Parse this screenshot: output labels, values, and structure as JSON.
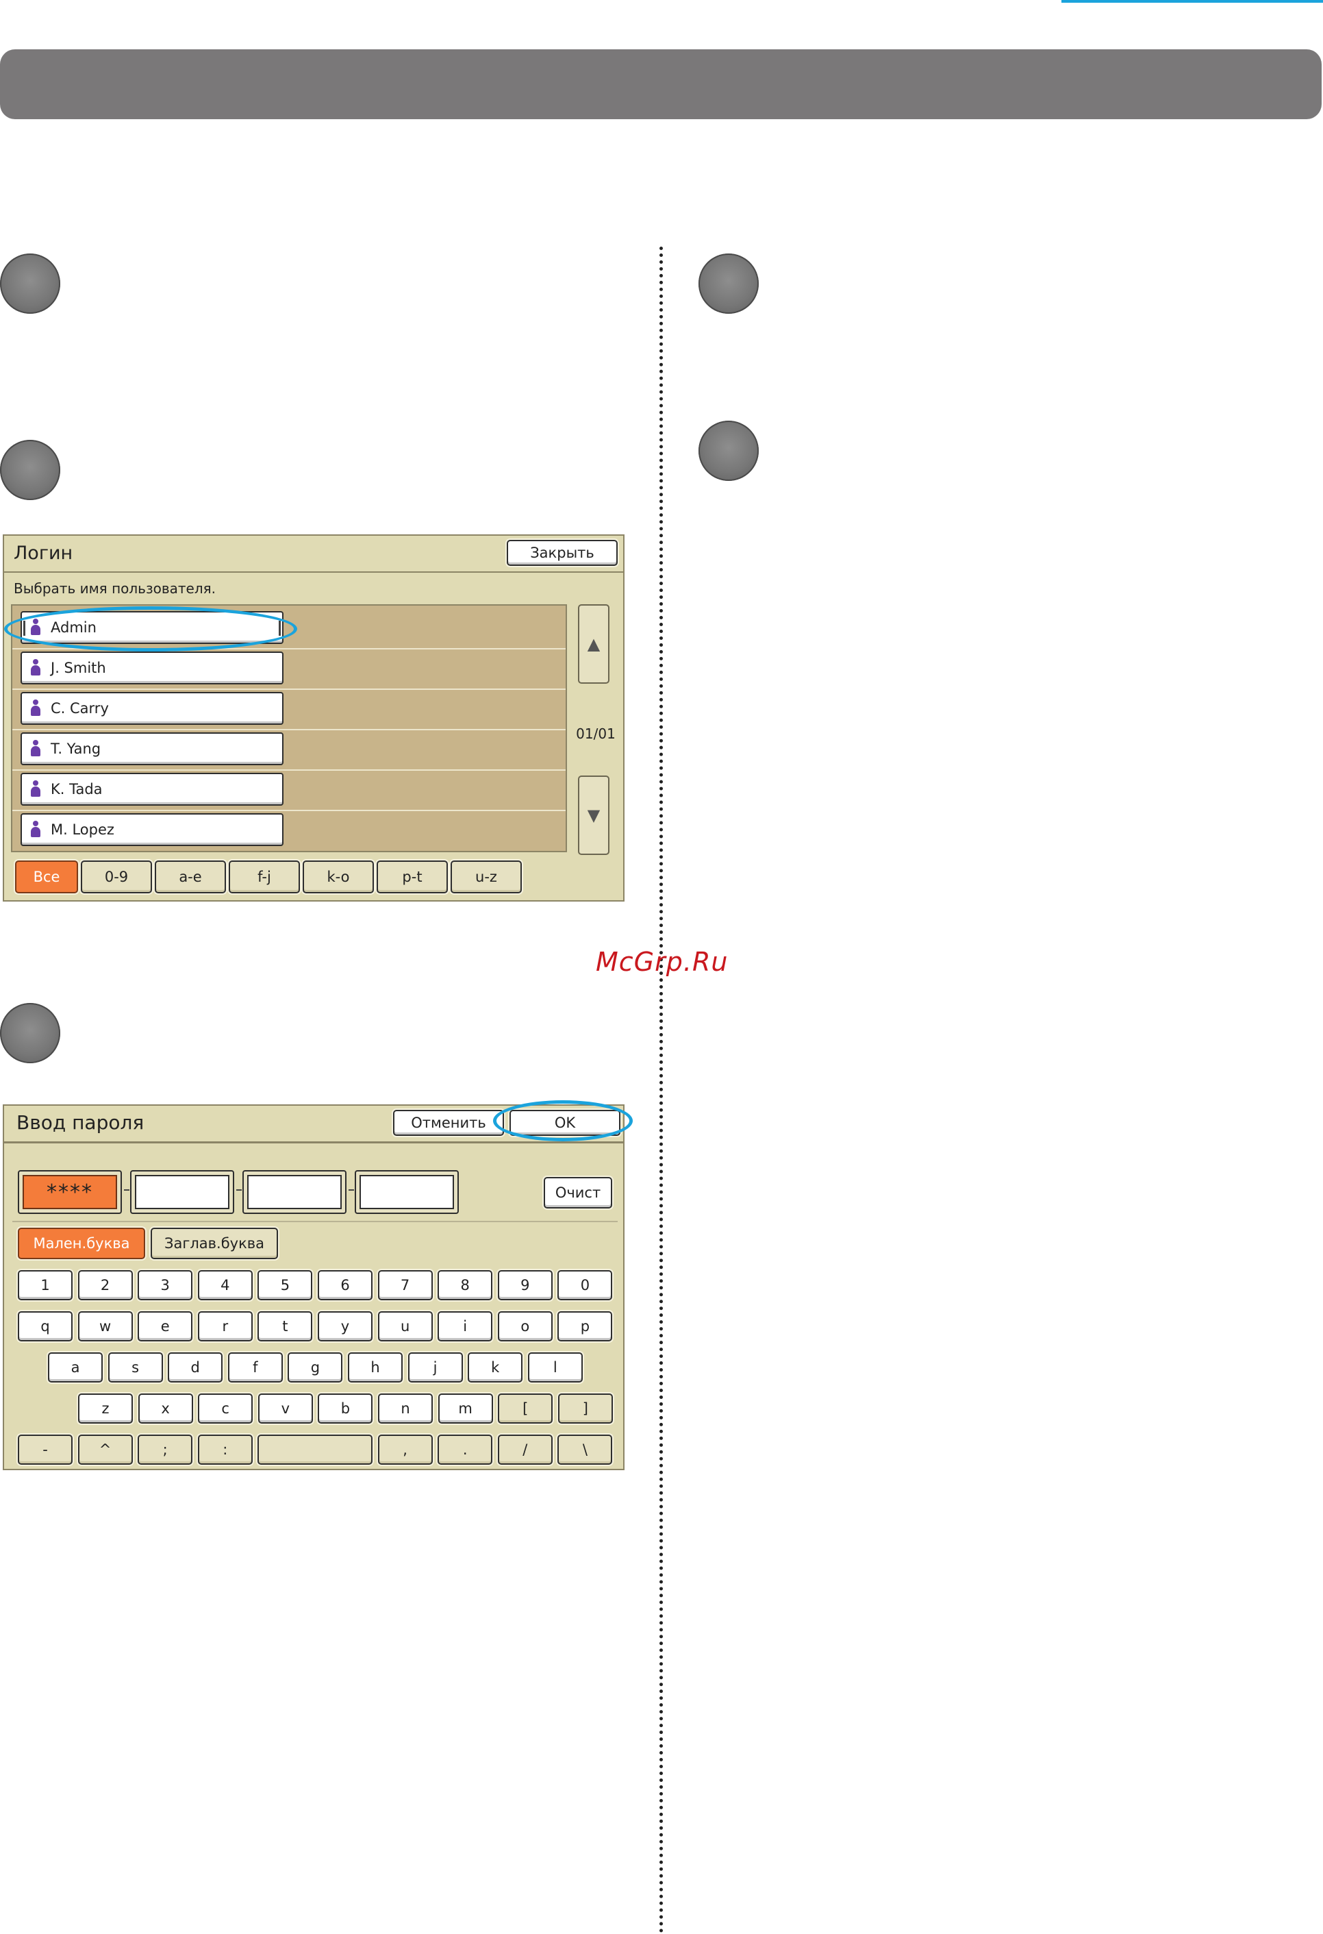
{
  "watermark": "McGrp.Ru",
  "colors": {
    "accent": "#1ba3dc",
    "header": "#7a7879",
    "panel": "#e0dbb4",
    "selected": "#f47c3a",
    "watermark": "#c9181e"
  },
  "login_panel": {
    "title": "Логин",
    "close_label": "Закрыть",
    "instruction": "Выбрать имя пользователя.",
    "users": [
      "Admin",
      "J. Smith",
      "C. Carry",
      "T. Yang",
      "K. Tada",
      "M. Lopez"
    ],
    "selected_user": "Admin",
    "page_indicator": "01/01",
    "scroll_up_icon": "▲",
    "scroll_down_icon": "▼",
    "filters": [
      "Все",
      "0-9",
      "a-e",
      "f-j",
      "k-o",
      "p-t",
      "u-z"
    ],
    "active_filter": "Все"
  },
  "password_panel": {
    "title": "Ввод пароля",
    "cancel_label": "Отменить",
    "ok_label": "OK",
    "password_masked": "****",
    "clear_label": "Очист",
    "case_lower_label": "Мален.буква",
    "case_upper_label": "Заглав.буква",
    "keyboard_rows": [
      [
        "1",
        "2",
        "3",
        "4",
        "5",
        "6",
        "7",
        "8",
        "9",
        "0"
      ],
      [
        "q",
        "w",
        "e",
        "r",
        "t",
        "y",
        "u",
        "i",
        "o",
        "p"
      ],
      [
        "a",
        "s",
        "d",
        "f",
        "g",
        "h",
        "j",
        "k",
        "l"
      ],
      [
        "z",
        "x",
        "c",
        "v",
        "b",
        "n",
        "m",
        "[",
        "]"
      ],
      [
        "-",
        "^",
        ";",
        ":",
        "",
        ",",
        ".",
        "/",
        "\\"
      ]
    ]
  }
}
